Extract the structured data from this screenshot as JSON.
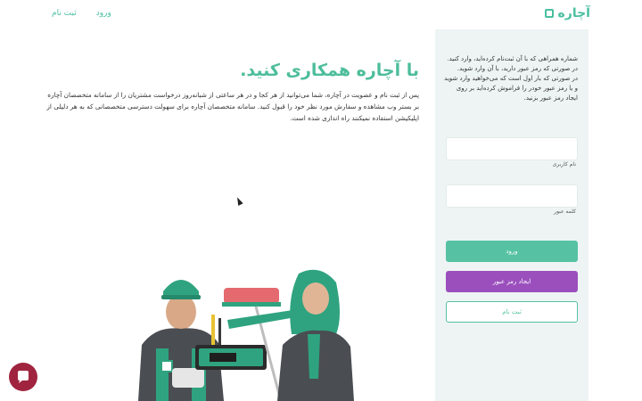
{
  "header": {
    "logo_text": "آچاره",
    "nav_login": "ورود",
    "nav_signup": "ثبت نام"
  },
  "main": {
    "headline": "با آچاره همکاری کنید.",
    "intro": "پس از ثبت نام و عضویت در آچاره، شما می‌توانید از هر کجا و در هر ساعتی از شبانه‌روز درخواست مشتریان را از سامانه متخصصان آچاره بر بستر وب مشاهده و سفارش مورد نظر خود را قبول کنید. سامانه متخصصان آچاره برای سهولت دسترسی متخصصانی که به هر دلیلی از اپلیکیشن استفاده نمیکنند راه اندازی شده است."
  },
  "panel": {
    "line1": "شماره همراهی که با آن ثبت‌نام کرده‌اید، وارد کنید.",
    "line2": "در صورتی که رمز عبور دارید، با آن وارد شوید.",
    "line3": "در صورتی که بار اول است که می‌خواهید وارد شوید و یا رمز عبور خودر را فراموش کرده‌اید بر روی ایجاد رمز عبور بزنید.",
    "username_label": "نام کاربری",
    "password_label": "کلمه عبور",
    "login_button": "ورود",
    "create_password_button": "ایجاد رمز عبور",
    "signup_button": "ثبت نام"
  },
  "colors": {
    "brand_green": "#4dbd9b",
    "purple": "#9b4fbd",
    "chat_red": "#a0243f"
  },
  "icons": {
    "chat": "chat-bubble-icon",
    "logo": "achareh-logo-icon"
  }
}
